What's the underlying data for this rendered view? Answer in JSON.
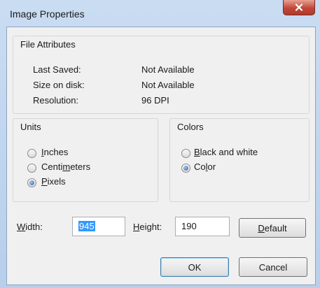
{
  "window": {
    "title": "Image Properties"
  },
  "file_attributes": {
    "title": "File Attributes",
    "rows": [
      {
        "label": "Last Saved:",
        "value": "Not Available"
      },
      {
        "label": "Size on disk:",
        "value": "Not Available"
      },
      {
        "label": "Resolution:",
        "value": "96 DPI"
      }
    ]
  },
  "units": {
    "title": "Units",
    "options": [
      {
        "pre": "",
        "mnemonic": "I",
        "post": "nches",
        "checked": false
      },
      {
        "pre": "Centi",
        "mnemonic": "m",
        "post": "eters",
        "checked": false
      },
      {
        "pre": "",
        "mnemonic": "P",
        "post": "ixels",
        "checked": true
      }
    ]
  },
  "colors": {
    "title": "Colors",
    "options": [
      {
        "pre": "",
        "mnemonic": "B",
        "post": "lack and white",
        "checked": false
      },
      {
        "pre": "Co",
        "mnemonic": "l",
        "post": "or",
        "checked": true
      }
    ]
  },
  "size": {
    "width_label": {
      "pre": "",
      "mnemonic": "W",
      "post": "idth:"
    },
    "width_value": "945",
    "height_label": {
      "pre": "",
      "mnemonic": "H",
      "post": "eight:"
    },
    "height_value": "190"
  },
  "buttons": {
    "default": {
      "pre": "",
      "mnemonic": "D",
      "post": "efault"
    },
    "ok": "OK",
    "cancel": "Cancel"
  },
  "icons": {
    "close": "close-icon"
  }
}
